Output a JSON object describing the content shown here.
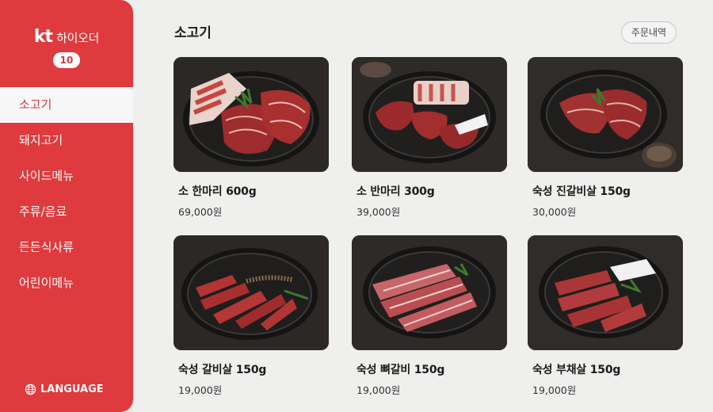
{
  "brand": {
    "logo_text": "kt",
    "service_name": "하이오더",
    "table_number": "10"
  },
  "sidebar": {
    "items": [
      {
        "label": "소고기",
        "active": true
      },
      {
        "label": "돼지고기",
        "active": false
      },
      {
        "label": "사이드메뉴",
        "active": false
      },
      {
        "label": "주류/음료",
        "active": false
      },
      {
        "label": "든든식사류",
        "active": false
      },
      {
        "label": "어린이메뉴",
        "active": false
      }
    ],
    "language_label": "LANGUAGE",
    "language_icon": "globe-icon"
  },
  "header": {
    "title": "소고기",
    "order_history_label": "주문내역"
  },
  "products": [
    {
      "name": "소 한마리 600g",
      "price": "69,000원"
    },
    {
      "name": "소 반마리 300g",
      "price": "39,000원"
    },
    {
      "name": "숙성 진갈비살 150g",
      "price": "30,000원"
    },
    {
      "name": "숙성 갈비살 150g",
      "price": "19,000원"
    },
    {
      "name": "숙성 뼈갈비 150g",
      "price": "19,000원"
    },
    {
      "name": "숙성 부채살 150g",
      "price": "19,000원"
    }
  ],
  "colors": {
    "sidebar_red": "#df3a3d",
    "active_text": "#d8393c",
    "background": "#efefee"
  }
}
